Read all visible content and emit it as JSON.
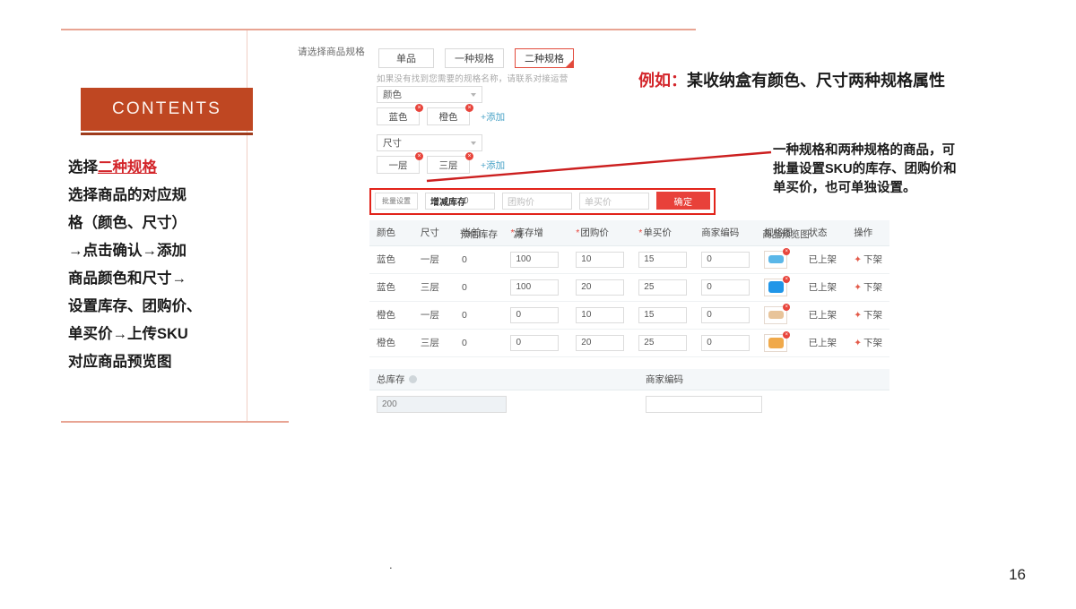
{
  "slide": {
    "contents_title": "CONTENTS",
    "page_number": "16",
    "dot_mark": ".",
    "left_lines": [
      {
        "prefix": "选择",
        "highlight": "二种规格",
        "suffix": ""
      },
      {
        "prefix": "选择商品的对应规",
        "highlight": "",
        "suffix": ""
      },
      {
        "prefix": "格（颜色、尺寸）",
        "highlight": "",
        "suffix": ""
      },
      {
        "prefix": "→点击确认→添加",
        "highlight": "",
        "suffix": ""
      },
      {
        "prefix": "商品颜色和尺寸→",
        "highlight": "",
        "suffix": ""
      },
      {
        "prefix": "设置库存、团购价、",
        "highlight": "",
        "suffix": ""
      },
      {
        "prefix": "单买价→上传SKU",
        "highlight": "",
        "suffix": ""
      },
      {
        "prefix": "对应商品预览图",
        "highlight": "",
        "suffix": ""
      }
    ]
  },
  "annotations": {
    "example_label": "例如：",
    "example_text": "某收纳盒有颜色、尺寸两种规格属性",
    "note_lines": [
      "一种规格和两种规格的商品，可",
      "批量设置SKU的库存、团购价和",
      "单买价，也可单独设置。"
    ],
    "arrow_color": "#cc1f1f"
  },
  "app": {
    "pick_spec_label": "请选择商品规格",
    "tabs": [
      {
        "label": "单品",
        "active": false
      },
      {
        "label": "一种规格",
        "active": false
      },
      {
        "label": "二种规格",
        "active": true
      }
    ],
    "hint": "如果没有找到您需要的规格名称，请联系对接运营",
    "spec_groups": [
      {
        "select_value": "颜色",
        "tags": [
          "蓝色",
          "橙色"
        ],
        "add_label": "+添加"
      },
      {
        "select_value": "尺寸",
        "tags": [
          "一层",
          "三层"
        ],
        "add_label": "+添加"
      }
    ],
    "batch": {
      "button_label": "批量设置",
      "stock_value": "增减库存",
      "stock_ghost": "0",
      "group_price_placeholder": "团购价",
      "single_price_placeholder": "单买价",
      "confirm_label": "确定"
    },
    "table": {
      "headers": [
        {
          "label": "颜色",
          "required": false,
          "overlap": ""
        },
        {
          "label": "尺寸",
          "required": false,
          "overlap": ""
        },
        {
          "label": "当前",
          "required": false,
          "overlap": "预估库存"
        },
        {
          "label": "库存增",
          "required": true,
          "overlap": "减"
        },
        {
          "label": "团购价",
          "required": true,
          "overlap": ""
        },
        {
          "label": "单买价",
          "required": true,
          "overlap": ""
        },
        {
          "label": "商家编码",
          "required": false,
          "overlap": ""
        },
        {
          "label": "规格图",
          "required": false,
          "overlap": "商品预览图"
        },
        {
          "label": "状态",
          "required": false,
          "overlap": ""
        },
        {
          "label": "操作",
          "required": false,
          "overlap": ""
        }
      ],
      "rows": [
        {
          "color": "蓝色",
          "size": "一层",
          "current_stock": "0",
          "stock_change": "100",
          "group_price": "10",
          "single_price": "15",
          "merchant_code": "0",
          "thumb_color": "#5bb7e8",
          "thumb_badge": "×",
          "status": "已上架",
          "action": "下架"
        },
        {
          "color": "蓝色",
          "size": "三层",
          "current_stock": "0",
          "stock_change": "100",
          "group_price": "20",
          "single_price": "25",
          "merchant_code": "0",
          "thumb_color": "#2196e8",
          "thumb_badge": "×",
          "status": "已上架",
          "action": "下架"
        },
        {
          "color": "橙色",
          "size": "一层",
          "current_stock": "0",
          "stock_change": "0",
          "group_price": "10",
          "single_price": "15",
          "merchant_code": "0",
          "thumb_color": "#e8c49a",
          "thumb_badge": "×",
          "status": "已上架",
          "action": "下架"
        },
        {
          "color": "橙色",
          "size": "三层",
          "current_stock": "0",
          "stock_change": "0",
          "group_price": "20",
          "single_price": "25",
          "merchant_code": "0",
          "thumb_color": "#f0a94a",
          "thumb_badge": "×",
          "status": "已上架",
          "action": "下架"
        }
      ]
    },
    "footer": {
      "total_stock_label": "总库存",
      "total_stock_value": "200",
      "merchant_code_label": "商家编码",
      "merchant_code_value": ""
    }
  }
}
